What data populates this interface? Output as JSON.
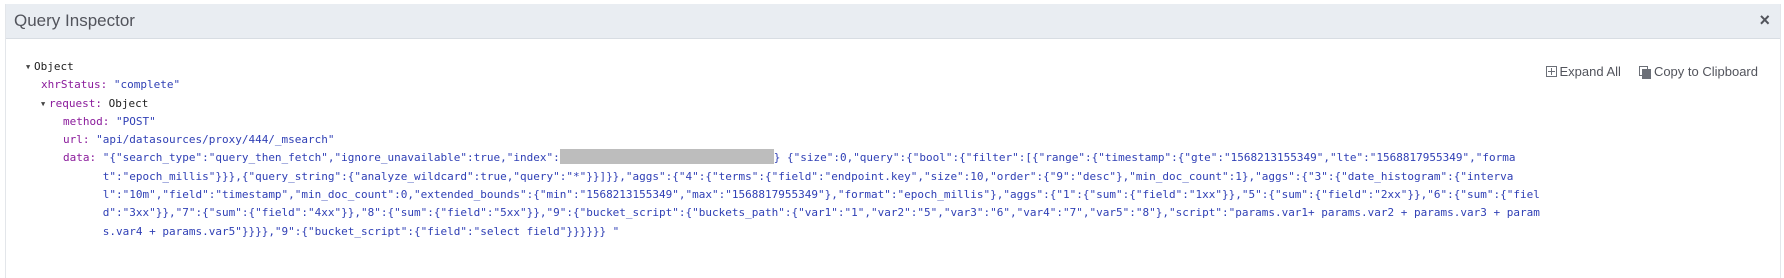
{
  "window": {
    "title": "Query Inspector",
    "close_symbol": "×"
  },
  "actions": {
    "expand_all": "Expand All",
    "copy": "Copy to Clipboard"
  },
  "tree": {
    "root_label": "Object",
    "xhr_key": "xhrStatus:",
    "xhr_value": "\"complete\"",
    "request_key": "request:",
    "request_label": "Object",
    "method_key": "method:",
    "method_value": "\"POST\"",
    "url_key": "url:",
    "url_value": "\"api/datasources/proxy/444/_msearch\"",
    "data_key": "data:",
    "data_prefix": "\"{\"search_type\":\"query_then_fetch\",\"ignore_unavailable\":true,\"index\":",
    "data_suffix": "} {\"size\":0,\"query\":{\"bool\":{\"filter\":[{\"range\":{\"timestamp\":{\"gte\":\"1568213155349\",\"lte\":\"1568817955349\",\"format\":\"epoch_millis\"}}},{\"query_string\":{\"analyze_wildcard\":true,\"query\":\"*\"}}]}},\"aggs\":{\"4\":{\"terms\":{\"field\":\"endpoint.key\",\"size\":10,\"order\":{\"9\":\"desc\"},\"min_doc_count\":1},\"aggs\":{\"3\":{\"date_histogram\":{\"interval\":\"10m\",\"field\":\"timestamp\",\"min_doc_count\":0,\"extended_bounds\":{\"min\":\"1568213155349\",\"max\":\"1568817955349\"},\"format\":\"epoch_millis\"},\"aggs\":{\"1\":{\"sum\":{\"field\":\"1xx\"}},\"5\":{\"sum\":{\"field\":\"2xx\"}},\"6\":{\"sum\":{\"field\":\"3xx\"}},\"7\":{\"sum\":{\"field\":\"4xx\"}},\"8\":{\"sum\":{\"field\":\"5xx\"}},\"9\":{\"bucket_script\":{\"buckets_path\":{\"var1\":\"1\",\"var2\":\"5\",\"var3\":\"6\",\"var4\":\"7\",\"var5\":\"8\"},\"script\":\"params.var1+ params.var2 + params.var3 + params.var4 + params.var5\"}}}},\"9\":{\"bucket_script\":{\"field\":\"select field\"}}}}}} \""
  }
}
